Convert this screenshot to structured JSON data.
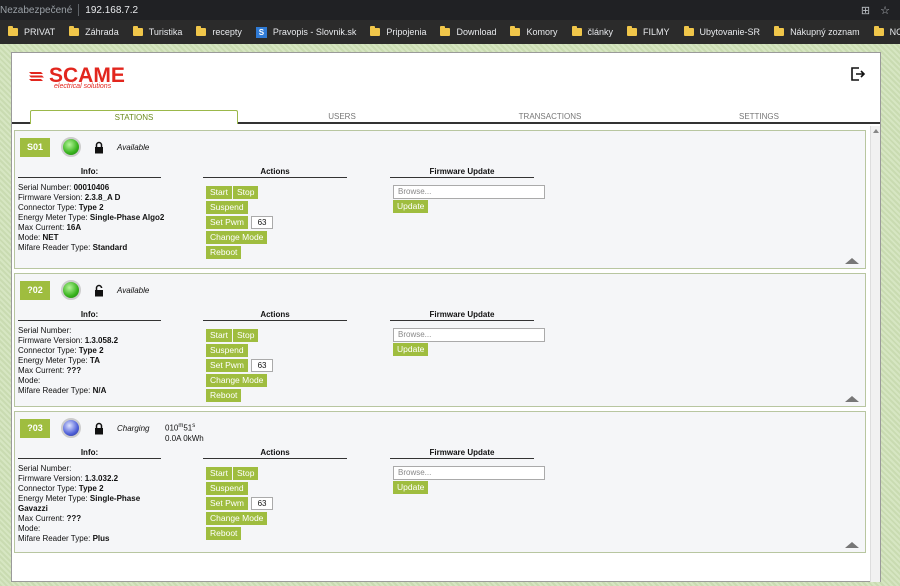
{
  "browser": {
    "security_label": "Nezabezpečené",
    "url": "192.168.7.2"
  },
  "bookmarks": [
    {
      "label": "PRIVAT",
      "icon": "folder"
    },
    {
      "label": "Záhrada",
      "icon": "folder"
    },
    {
      "label": "Turistika",
      "icon": "folder"
    },
    {
      "label": "recepty",
      "icon": "folder"
    },
    {
      "label": "Pravopis - Slovnik.sk",
      "icon": "site"
    },
    {
      "label": "Pripojenia",
      "icon": "folder"
    },
    {
      "label": "Download",
      "icon": "folder"
    },
    {
      "label": "Komory",
      "icon": "folder"
    },
    {
      "label": "články",
      "icon": "folder"
    },
    {
      "label": "FILMY",
      "icon": "folder"
    },
    {
      "label": "Ubytovanie-SR",
      "icon": "folder"
    },
    {
      "label": "Nákupný zoznam",
      "icon": "folder"
    },
    {
      "label": "NOTY",
      "icon": "folder"
    }
  ],
  "logo": {
    "word": "SCAME",
    "tagline": "electrical solutions"
  },
  "tabs": [
    "STATIONS",
    "USERS",
    "TRANSACTIONS",
    "SETTINGS"
  ],
  "labels": {
    "info": "Info:",
    "actions": "Actions",
    "firmware": "Firmware Update",
    "serial": "Serial Number:",
    "fw_version": "Firmware Version:",
    "connector": "Connector Type:",
    "meter": "Energy Meter Type:",
    "max_current": "Max Current:",
    "mode": "Mode:",
    "mifare": "Mifare Reader Type:",
    "start": "Start",
    "stop": "Stop",
    "suspend": "Suspend",
    "set_pwm": "Set Pwm",
    "change_mode": "Change Mode",
    "reboot": "Reboot",
    "browse_placeholder": "Browse...",
    "update": "Update"
  },
  "stations": [
    {
      "id": "S01",
      "led": "green",
      "locked": true,
      "status": "Available",
      "extra_line1": "",
      "extra_line2": "",
      "serial": "00010406",
      "fw_version": "2.3.8_A D",
      "connector": "Type 2",
      "meter": "Single-Phase Algo2",
      "max_current": "16A",
      "mode": "NET",
      "mifare": "Standard",
      "pwm": "63"
    },
    {
      "id": "?02",
      "led": "green",
      "locked": false,
      "status": "Available",
      "extra_line1": "",
      "extra_line2": "",
      "serial": "",
      "fw_version": "1.3.058.2",
      "connector": "Type 2",
      "meter": "TA",
      "max_current": "???",
      "mode": "",
      "mifare": "N/A",
      "pwm": "63"
    },
    {
      "id": "?03",
      "led": "blue",
      "locked": true,
      "status": "Charging",
      "extra_line1": "010m51s",
      "extra_line2": "0.0A 0kWh",
      "serial": "",
      "fw_version": "1.3.032.2",
      "connector": "Type 2",
      "meter": "Single-Phase Gavazzi",
      "max_current": "???",
      "mode": "",
      "mifare": "Plus",
      "pwm": "63"
    }
  ]
}
